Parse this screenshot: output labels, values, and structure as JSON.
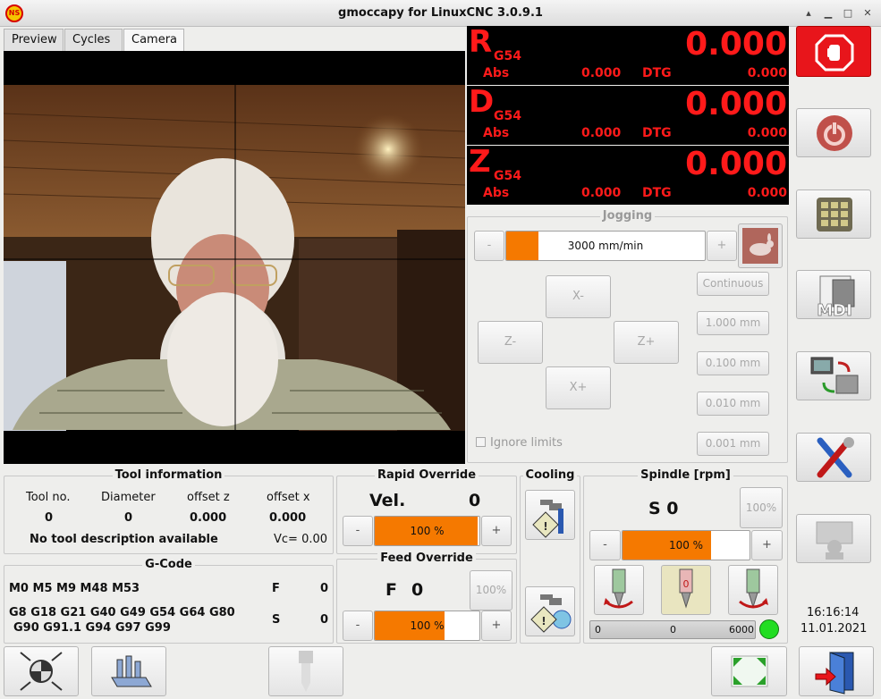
{
  "window": {
    "title": "gmoccapy for LinuxCNC  3.0.9.1",
    "logo_text": "NS"
  },
  "tabs": [
    {
      "label": "Preview"
    },
    {
      "label": "Cycles"
    },
    {
      "label": "Camera"
    }
  ],
  "dro": [
    {
      "axis": "R",
      "coord_system": "G54",
      "value": "0.000",
      "abs_label": "Abs",
      "abs_value": "0.000",
      "dtg_label": "DTG",
      "dtg_value": "0.000"
    },
    {
      "axis": "D",
      "coord_system": "G54",
      "value": "0.000",
      "abs_label": "Abs",
      "abs_value": "0.000",
      "dtg_label": "DTG",
      "dtg_value": "0.000"
    },
    {
      "axis": "Z",
      "coord_system": "G54",
      "value": "0.000",
      "abs_label": "Abs",
      "abs_value": "0.000",
      "dtg_label": "DTG",
      "dtg_value": "0.000"
    }
  ],
  "jogging": {
    "title": "Jogging",
    "minus": "-",
    "plus": "+",
    "speed": "3000 mm/min",
    "speed_fraction": 0.16,
    "x_minus": "X-",
    "x_plus": "X+",
    "z_minus": "Z-",
    "z_plus": "Z+",
    "ignore_limits": "Ignore limits",
    "increments": [
      "Continuous",
      "1.000 mm",
      "0.100 mm",
      "0.010 mm",
      "0.001 mm"
    ]
  },
  "tool_info": {
    "title": "Tool information",
    "headers": [
      "Tool no.",
      "Diameter",
      "offset z",
      "offset x"
    ],
    "values": [
      "0",
      "0",
      "0.000",
      "0.000"
    ],
    "description": "No tool description available",
    "vc": "Vc= 0.00"
  },
  "gcode": {
    "title": "G-Code",
    "mcodes": "M0 M5 M9 M48 M53",
    "f_label": "F",
    "f_value": "0",
    "gcodes_line1": "G8 G18 G21 G40 G49 G54 G64 G80",
    "gcodes_line2": "G90 G91.1 G94 G97 G99",
    "s_label": "S",
    "s_value": "0"
  },
  "rapid_override": {
    "title": "Rapid Override",
    "vel_label": "Vel.",
    "vel_value": "0",
    "minus": "-",
    "plus": "+",
    "value": "100 %",
    "fraction": 0.98
  },
  "feed_override": {
    "title": "Feed Override",
    "f_label": "F",
    "f_value": "0",
    "reset": "100%",
    "minus": "-",
    "plus": "+",
    "value": "100 %",
    "fraction": 0.67
  },
  "cooling": {
    "title": "Cooling"
  },
  "spindle": {
    "title": "Spindle [rpm]",
    "speed": "S 0",
    "reset": "100%",
    "minus": "-",
    "plus": "+",
    "value": "100 %",
    "fraction": 0.7,
    "scale_min": "0",
    "scale_mid": "0",
    "scale_max": "6000"
  },
  "clock": {
    "time": "16:16:14",
    "date": "11.01.2021"
  },
  "colors": {
    "dro_text": "#ff1a1a",
    "accent": "#f57900",
    "estop": "#e8151b",
    "led": "#22dd22"
  }
}
